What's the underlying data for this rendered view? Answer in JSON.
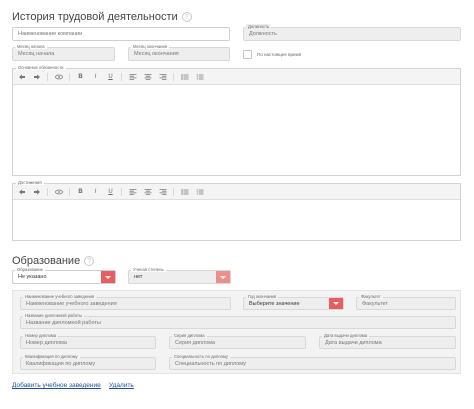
{
  "work": {
    "title": "История трудовой деятельности",
    "company_placeholder": "Наименование компании",
    "position_label": "Должность",
    "position_placeholder": "Должность",
    "start_label": "Месяц начала",
    "start_placeholder": "Месяц начала",
    "end_label": "Месяц окончания",
    "end_placeholder": "Месяц окончания",
    "current_label": "По настоящее время",
    "duties_label": "Основные обязанности",
    "achievements_label": "Достижения"
  },
  "toolbar_icons": [
    "undo-icon",
    "redo-icon",
    "preview-icon",
    "bold-icon",
    "italic-icon",
    "underline-icon",
    "align-left-icon",
    "align-center-icon",
    "align-right-icon",
    "bullet-list-icon",
    "numbered-list-icon"
  ],
  "toolbar_glyphs": {
    "bold": "B",
    "italic": "I",
    "underline": "U"
  },
  "education": {
    "title": "Образование",
    "education_label": "Образование",
    "education_value": "Не указано",
    "degree_label": "Ученая степень",
    "degree_value": "нет",
    "institution_label": "Наименование учебного заведения",
    "institution_placeholder": "Наименование учебного заведения",
    "grad_year_label": "Год окончания",
    "grad_year_value": "Выберите значение",
    "faculty_label": "Факультет",
    "faculty_placeholder": "Факультет",
    "thesis_label": "Название дипломной работы",
    "thesis_placeholder": "Название дипломной работы",
    "diploma_no_label": "Номер диплома",
    "diploma_no_placeholder": "Номер диплома",
    "diploma_series_label": "Серия диплома",
    "diploma_series_placeholder": "Серия диплома",
    "diploma_date_label": "Дата выдачи диплома",
    "diploma_date_placeholder": "Дата выдачи диплома",
    "qualification_label": "Квалификация по диплому",
    "qualification_placeholder": "Квалификация по диплому",
    "specialty_label": "Специальность по диплому",
    "specialty_placeholder": "Специальность по диплому"
  },
  "actions": {
    "add_label": "Добавить учебное заведение",
    "delete_label": "Удалить"
  },
  "colors": {
    "accent": "#e85d5d",
    "accent_light": "#f08c8c",
    "link": "#1f4f9b"
  }
}
